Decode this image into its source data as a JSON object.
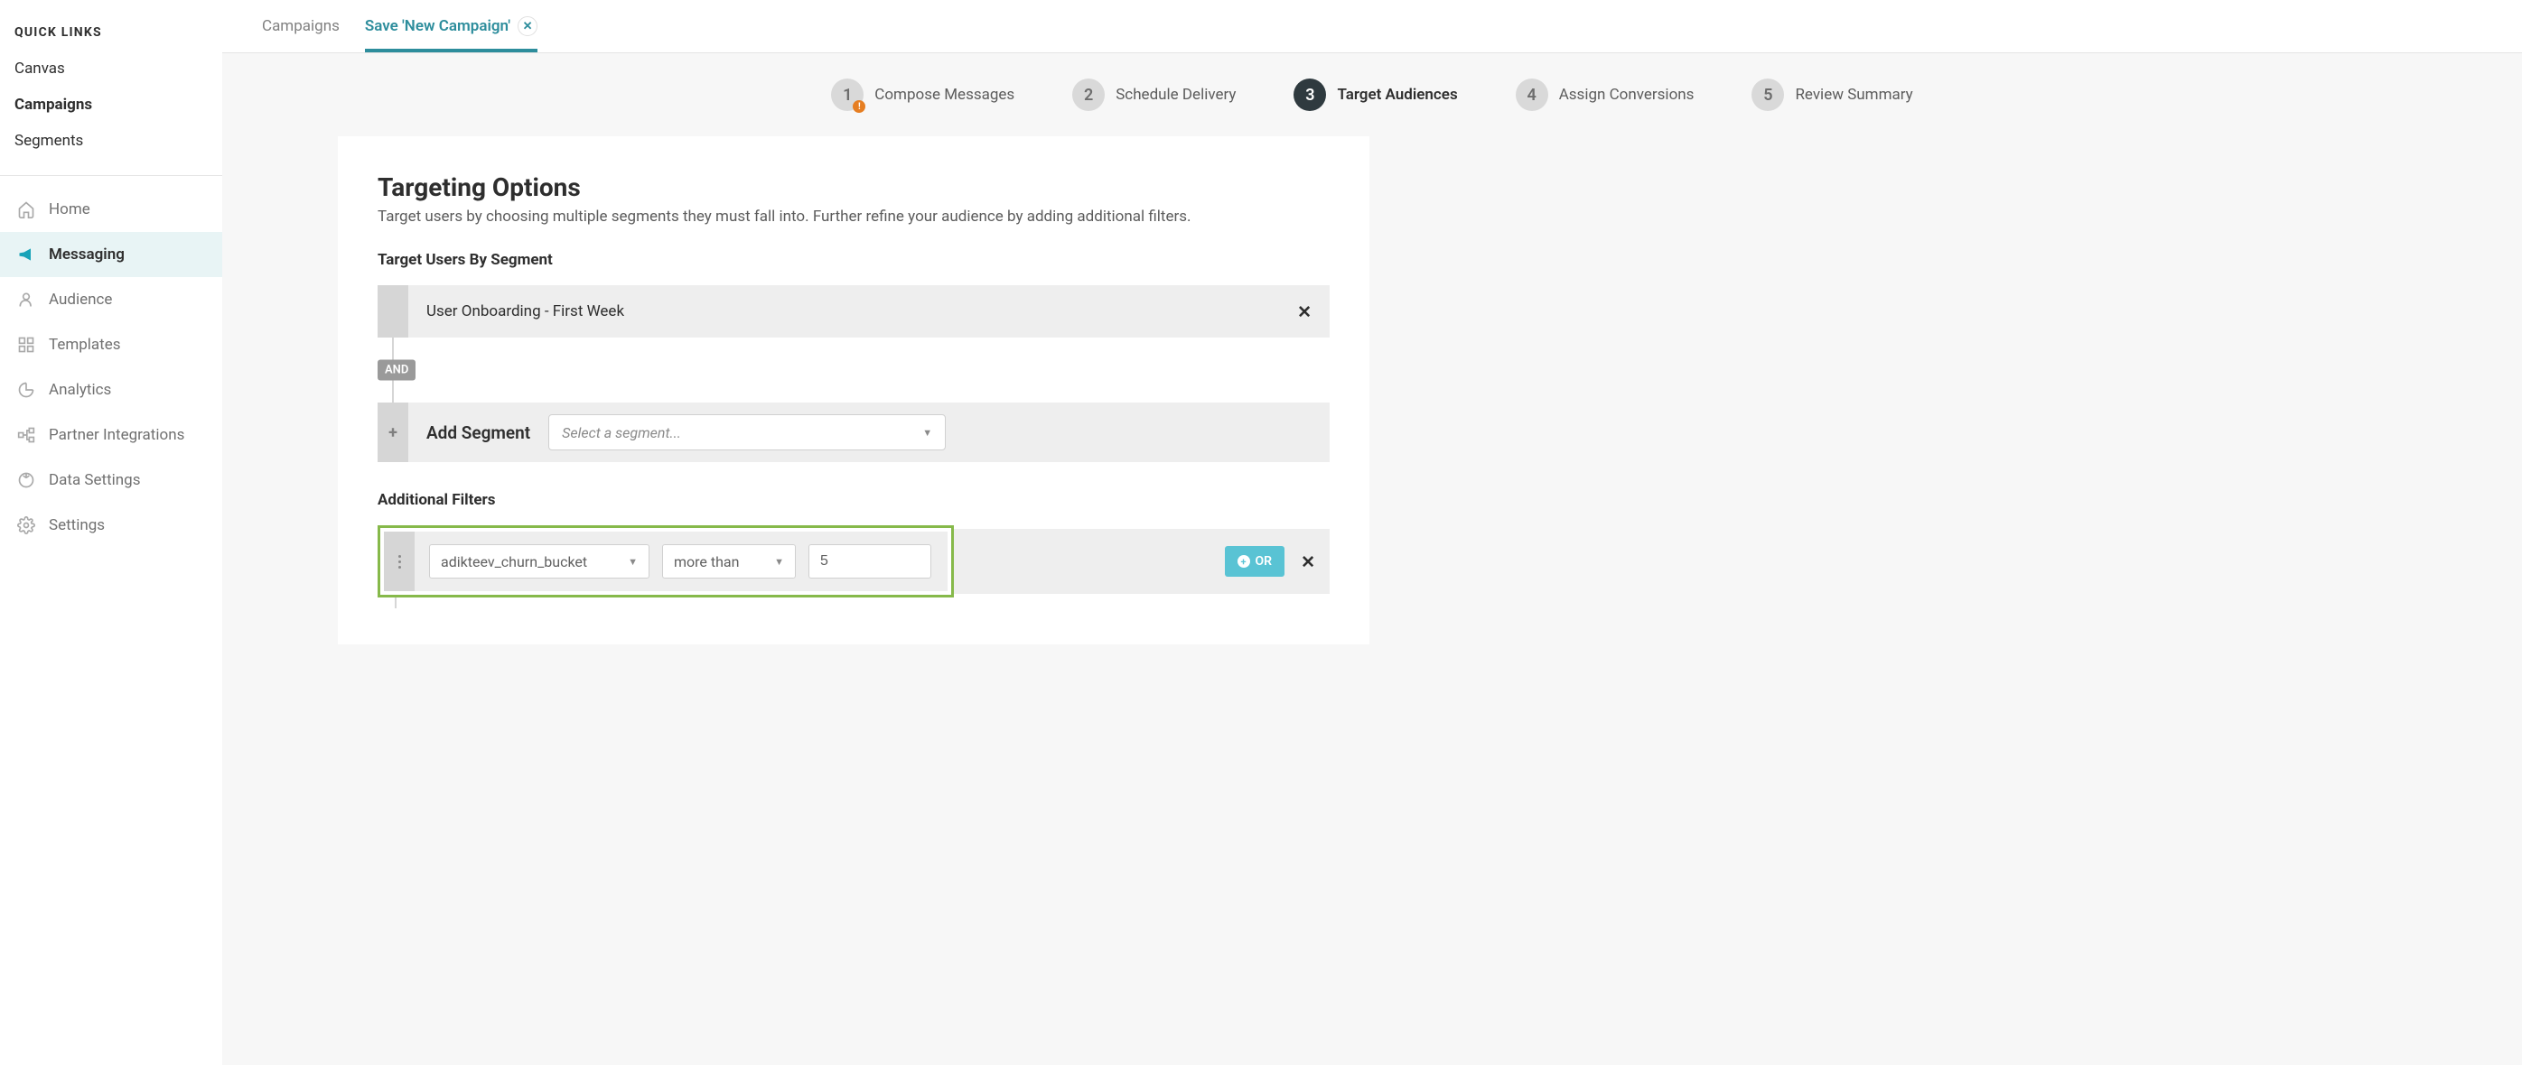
{
  "sidebar": {
    "quick_links_header": "QUICK LINKS",
    "quick_links": [
      {
        "label": "Canvas"
      },
      {
        "label": "Campaigns",
        "active": true
      },
      {
        "label": "Segments"
      }
    ],
    "nav": [
      {
        "label": "Home",
        "icon": "home-icon"
      },
      {
        "label": "Messaging",
        "icon": "megaphone-icon",
        "active": true
      },
      {
        "label": "Audience",
        "icon": "audience-icon"
      },
      {
        "label": "Templates",
        "icon": "templates-icon"
      },
      {
        "label": "Analytics",
        "icon": "analytics-icon"
      },
      {
        "label": "Partner Integrations",
        "icon": "integrations-icon"
      },
      {
        "label": "Data Settings",
        "icon": "data-settings-icon"
      },
      {
        "label": "Settings",
        "icon": "settings-icon"
      }
    ]
  },
  "tabs": [
    {
      "label": "Campaigns"
    },
    {
      "label": "Save 'New Campaign'",
      "active": true,
      "closable": true
    }
  ],
  "stepper": [
    {
      "num": "1",
      "label": "Compose Messages",
      "alert": true
    },
    {
      "num": "2",
      "label": "Schedule Delivery"
    },
    {
      "num": "3",
      "label": "Target Audiences",
      "active": true
    },
    {
      "num": "4",
      "label": "Assign Conversions"
    },
    {
      "num": "5",
      "label": "Review Summary"
    }
  ],
  "targeting": {
    "title": "Targeting Options",
    "subtitle": "Target users by choosing multiple segments they must fall into. Further refine your audience by adding additional filters.",
    "segment_section_label": "Target Users By Segment",
    "segment_name": "User Onboarding - First Week",
    "and_label": "AND",
    "add_segment_label": "Add Segment",
    "segment_select_placeholder": "Select a segment...",
    "filters_section_label": "Additional Filters",
    "filter": {
      "attribute": "adikteev_churn_bucket",
      "operator": "more than",
      "value": "5"
    },
    "or_label": "OR"
  }
}
